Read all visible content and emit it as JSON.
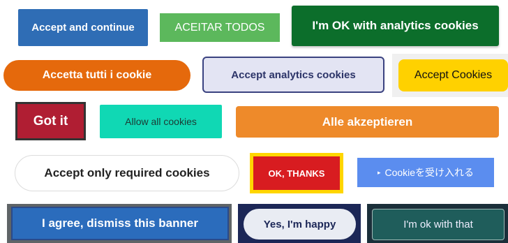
{
  "buttons": {
    "accept_and_continue": "Accept and continue",
    "aceitar_todos": "ACEITAR TODOS",
    "ok_with_analytics": "I'm OK with analytics cookies",
    "accetta_tutti": "Accetta tutti i cookie",
    "accept_analytics": "Accept analytics cookies",
    "accept_cookies": "Accept Cookies",
    "got_it": "Got it",
    "allow_all": "Allow all cookies",
    "alle_akzeptieren": "Alle akzeptieren",
    "accept_required": "Accept only required cookies",
    "ok_thanks": "OK, THANKS",
    "cookie_accept_jp": "Cookieを受け入れる",
    "i_agree_dismiss": "I agree, dismiss this banner",
    "yes_happy": "Yes, I'm happy",
    "ok_with_that": "I'm ok with that"
  },
  "icons": {
    "cookie_jp_arrow": "▸"
  },
  "colors": {
    "blue": "#2f6db5",
    "green": "#5cb85c",
    "dark_green": "#0c6e2b",
    "orange": "#e5690c",
    "yellow": "#ffd100",
    "crimson": "#b01e33",
    "teal": "#10d8b4",
    "red": "#d81c20",
    "periwinkle": "#5b8def",
    "navy": "#1c2757",
    "dark_teal": "#1f5d5b"
  }
}
